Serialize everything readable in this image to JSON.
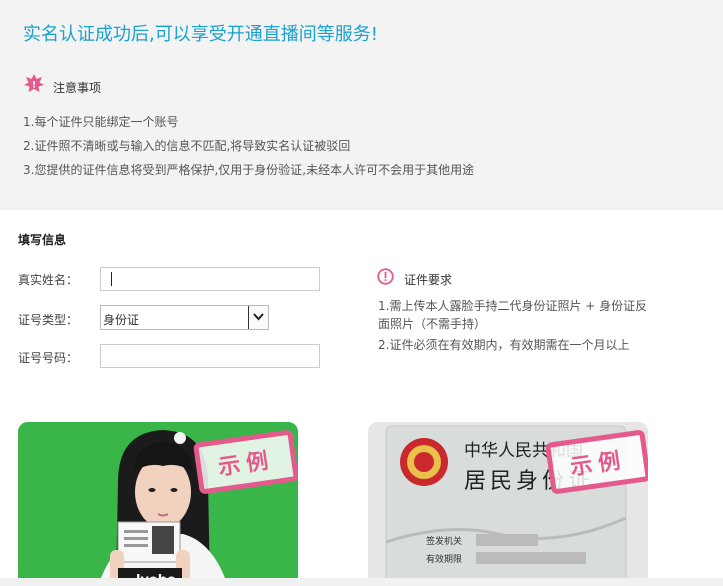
{
  "headline": "实名认证成功后,可以享受开通直播间等服务!",
  "notice": {
    "title": "注意事项",
    "items": [
      "1.每个证件只能绑定一个账号",
      "2.证件照不清晰或与输入的信息不匹配,将导致实名认证被驳回",
      "3.您提供的证件信息将受到严格保护,仅用于身份验证,未经本人许可不会用于其他用途"
    ]
  },
  "form": {
    "title": "填写信息",
    "name_label": "真实姓名：",
    "name_value": "",
    "id_type_label": "证号类型：",
    "id_type_value": "身份证",
    "id_number_label": "证号号码：",
    "id_number_value": ""
  },
  "requirements": {
    "title": "证件要求",
    "items": [
      "1.需上传本人露脸手持二代身份证照片 + 身份证反面照片（不需手持）",
      "2.证件必须在有效期内，有效期需在一个月以上"
    ]
  },
  "examples": {
    "stamp_label": "示例",
    "id_card_lines": [
      "中华人民共和国",
      "居民身份证",
      "签发机关",
      "有效期限"
    ]
  },
  "colors": {
    "headline": "#1aa1d0",
    "accent": "#e45a8d",
    "green_bg": "#39b54a"
  }
}
